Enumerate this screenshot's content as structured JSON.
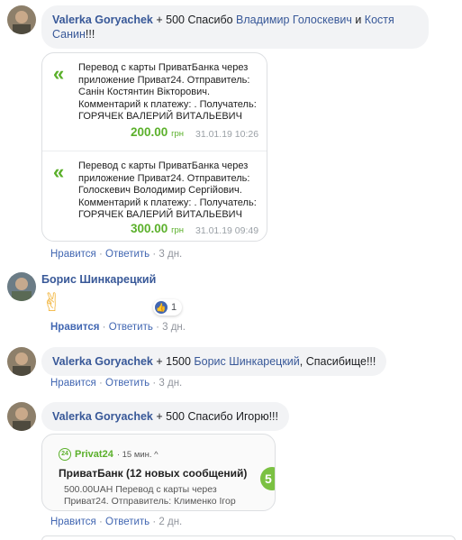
{
  "comments": [
    {
      "author": "Valerka Goryachek",
      "text_plain_1": " + 500 Спасибо ",
      "mention_1": "Владимир Голоскевич",
      "text_plain_2": " и ",
      "mention_2": "Костя",
      "mention_2b": "Санин",
      "text_plain_3": "!!!",
      "attachment": {
        "messages": [
          {
            "text": "Перевод с карты ПриватБанка через приложение Приват24. Отправитель: Санін Костянтин Вікторович. Комментарий к платежу: . Получатель: ГОРЯЧЕК ВАЛЕРИЙ ВИТАЛЬЕВИЧ",
            "amount": "200.00",
            "currency": "грн",
            "datetime": "31.01.19 10:26"
          },
          {
            "text": "Перевод с карты ПриватБанка через приложение Приват24. Отправитель: Голоскевич Володимир Сергійович. Комментарий к платежу: . Получатель: ГОРЯЧЕК ВАЛЕРИЙ ВИТАЛЬЕВИЧ",
            "amount": "300.00",
            "currency": "грн",
            "datetime": "31.01.19 09:49"
          }
        ]
      },
      "actions": {
        "like": "Нравится",
        "reply": "Ответить",
        "time": "3 дн."
      }
    },
    {
      "author": "Борис Шинкарецкий",
      "emoji": "✌",
      "reaction_count": "1",
      "actions": {
        "like": "Нравится",
        "reply": "Ответить",
        "time": "3 дн."
      }
    },
    {
      "author": "Valerka Goryachek",
      "text_plain_1": " + 1500 ",
      "mention_1": "Борис Шинкарецкий",
      "text_plain_2": ", Спасибище!!!",
      "actions": {
        "like": "Нравится",
        "reply": "Ответить",
        "time": "3 дн."
      }
    },
    {
      "author": "Valerka Goryachek",
      "text_plain_1": " + 500 Спасибо Игорю!!!",
      "notification": {
        "app_icon": "24",
        "app": "Privat24",
        "time": "· 15 мин. ^",
        "title": "ПриватБанк (12 новых сообщений)",
        "line1": "500.00UAH Перевод с карты через",
        "line2": "Приват24. Отправитель: Клименко Ігор",
        "side_badge": "5"
      },
      "actions": {
        "like": "Нравится",
        "reply": "Ответить",
        "time": "2 дн."
      }
    }
  ],
  "separator": "·",
  "colors": {
    "link": "#385898",
    "action": "#4267b2",
    "privat_green": "#5bb02b",
    "bubble_bg": "#f2f3f5"
  }
}
